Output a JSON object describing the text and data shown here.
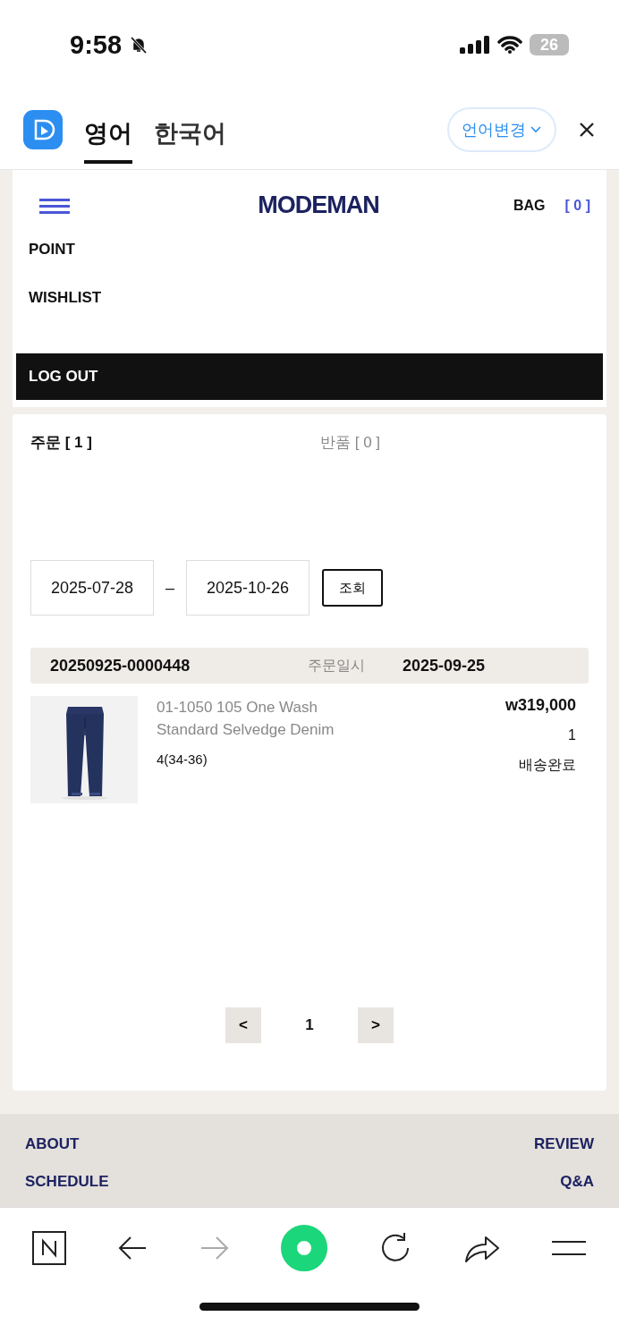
{
  "status_bar": {
    "time": "9:58",
    "battery": "26"
  },
  "translate_bar": {
    "languages": [
      {
        "label": "영어",
        "selected": true
      },
      {
        "label": "한국어",
        "selected": false
      }
    ],
    "change_button": "언어변경"
  },
  "header": {
    "logo": "MODEMAN",
    "bag_label": "BAG",
    "bag_count": "[ 0 ]"
  },
  "menu": {
    "items": [
      "POINT",
      "WISHLIST"
    ],
    "logout": "LOG OUT"
  },
  "order_tabs": [
    {
      "label": "주문 [ 1 ]",
      "selected": true
    },
    {
      "label": "반품 [ 0 ]",
      "selected": false
    }
  ],
  "date_filter": {
    "from": "2025-07-28",
    "separator": "–",
    "to": "2025-10-26",
    "search_button": "조회"
  },
  "orders": [
    {
      "number": "20250925-0000448",
      "date_label": "주문일시",
      "date": "2025-09-25",
      "items": [
        {
          "name": "01-1050 105 One Wash Standard Selvedge Denim",
          "option": "4(34-36)",
          "price": "w319,000",
          "quantity": "1",
          "status": "배송완료"
        }
      ]
    }
  ],
  "pagination": {
    "prev": "<",
    "pages": [
      {
        "label": "1",
        "selected": true
      }
    ],
    "next": ">"
  },
  "footer": {
    "left": [
      "ABOUT",
      "SCHEDULE"
    ],
    "right": [
      "REVIEW",
      "Q&A"
    ]
  }
}
